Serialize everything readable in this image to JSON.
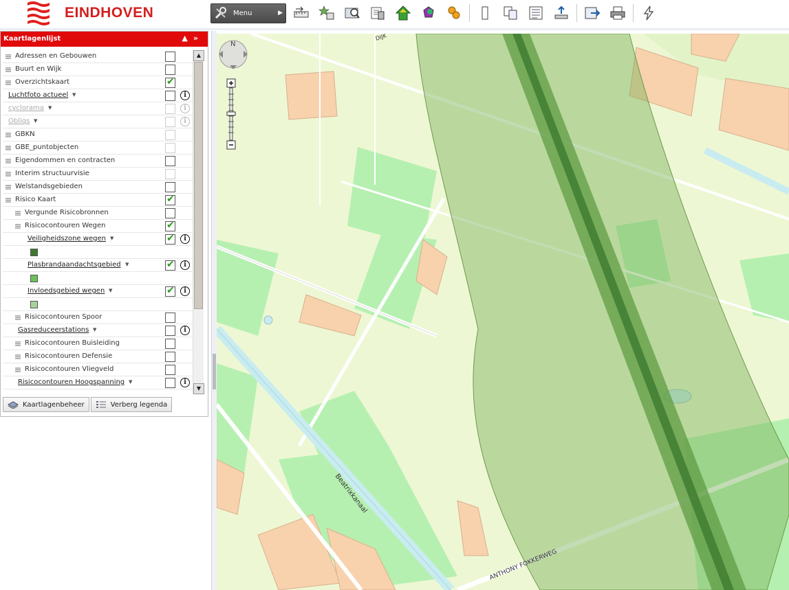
{
  "header": {
    "brand": "EINDHOVEN",
    "menu_label": "Menu",
    "brand_color": "#d41e1e"
  },
  "toolbar_icons": [
    "measure-icon",
    "favorites-icon",
    "search-icon",
    "document-search-icon",
    "home-icon",
    "bookmark-icon",
    "coins-icon",
    "single-page-icon",
    "copy-icon",
    "list-icon",
    "upload-icon",
    "export-icon",
    "print-icon",
    "lightning-icon"
  ],
  "panel": {
    "title": "Kaartlagenlijst",
    "layers": [
      {
        "name": "Adressen en Gebouwen",
        "indent": 0,
        "checked": false,
        "style": "plain"
      },
      {
        "name": "Buurt en Wijk",
        "indent": 0,
        "checked": false,
        "style": "plain"
      },
      {
        "name": "Overzichtskaart",
        "indent": 0,
        "checked": true,
        "style": "plain"
      },
      {
        "name": "Luchtfoto actueel",
        "indent": 0,
        "checked": false,
        "style": "link",
        "info": true
      },
      {
        "name": "cyclorama",
        "indent": 0,
        "checked": false,
        "style": "dim",
        "info": true,
        "disabled": true
      },
      {
        "name": "Obliqs",
        "indent": 0,
        "checked": false,
        "style": "dim",
        "info": true,
        "disabled": true
      },
      {
        "name": "GBKN",
        "indent": 0,
        "checked": false,
        "style": "plain",
        "disabled": true
      },
      {
        "name": "GBE_puntobjecten",
        "indent": 0,
        "checked": false,
        "style": "plain",
        "disabled": true
      },
      {
        "name": "Eigendommen en contracten",
        "indent": 0,
        "checked": false,
        "style": "plain"
      },
      {
        "name": "Interim structuurvisie",
        "indent": 0,
        "checked": false,
        "style": "plain",
        "disabled": true
      },
      {
        "name": "Welstandsgebieden",
        "indent": 0,
        "checked": false,
        "style": "plain"
      },
      {
        "name": "Risico Kaart",
        "indent": 0,
        "checked": true,
        "style": "plain"
      },
      {
        "name": "Vergunde Risicobronnen",
        "indent": 1,
        "checked": false,
        "style": "plain"
      },
      {
        "name": "Risicocontouren Wegen",
        "indent": 1,
        "checked": true,
        "style": "plain"
      },
      {
        "name": "Veiligheidszone wegen",
        "indent": 2,
        "checked": true,
        "style": "link",
        "info": true
      },
      {
        "swatch": "#3d7a2e"
      },
      {
        "name": "Plasbrandaandachtsgebied",
        "indent": 2,
        "checked": true,
        "style": "link",
        "info": true
      },
      {
        "swatch": "#6cc05a"
      },
      {
        "name": "Invloedsgebied wegen",
        "indent": 2,
        "checked": true,
        "style": "link",
        "info": true
      },
      {
        "swatch": "#a5d398"
      },
      {
        "name": "Risicocontouren Spoor",
        "indent": 1,
        "checked": false,
        "style": "plain"
      },
      {
        "name": "Gasreduceerstations",
        "indent": 1,
        "checked": false,
        "style": "link",
        "info": true
      },
      {
        "name": "Risicocontouren Buisleiding",
        "indent": 1,
        "checked": false,
        "style": "plain"
      },
      {
        "name": "Risicocontouren Defensie",
        "indent": 1,
        "checked": false,
        "style": "plain"
      },
      {
        "name": "Risicocontouren Vliegveld",
        "indent": 1,
        "checked": false,
        "style": "plain"
      },
      {
        "name": "Risicocontouren Hoogspanning",
        "indent": 1,
        "checked": false,
        "style": "link",
        "info": true
      }
    ],
    "buttons": {
      "manage": "Kaartlagenbeheer",
      "legend": "Verberg legenda"
    }
  },
  "map": {
    "labels": {
      "canal": "Beatrixkanaal",
      "road": "ANTHONY FOKKERWEG",
      "top_street": "DIJK"
    },
    "colors": {
      "bg": "#eef7d4",
      "green": "#b6f0b1",
      "building": "#f7d2ad",
      "road": "#ffffff",
      "water": "#c9ecf0",
      "risk_outer": "#9ac27a",
      "risk_inner": "#3d7a2e"
    }
  }
}
